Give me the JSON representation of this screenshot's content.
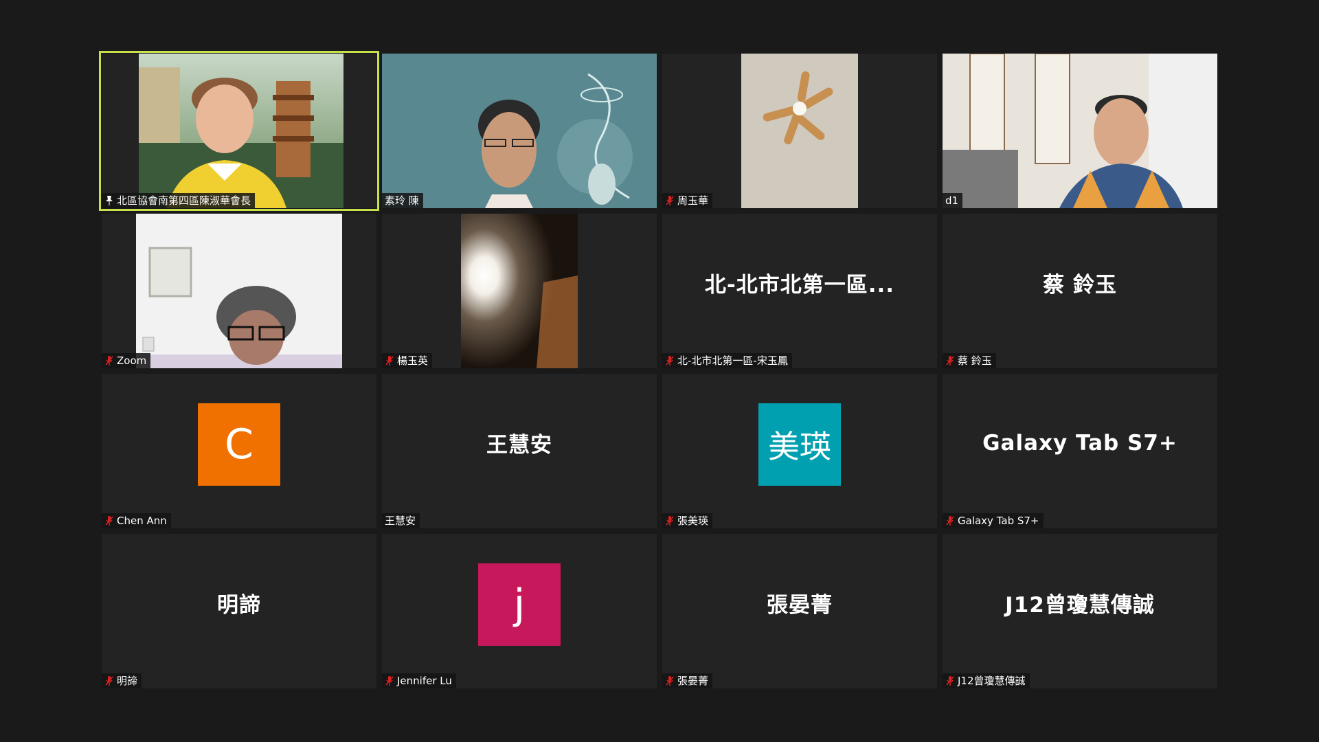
{
  "tiles": [
    {
      "name": "北區協會南第四區陳淑華會長",
      "big": "",
      "avatar": "",
      "color": ""
    },
    {
      "name": "素玲 陳",
      "big": "",
      "avatar": "",
      "color": ""
    },
    {
      "name": "周玉華",
      "big": "",
      "avatar": "",
      "color": ""
    },
    {
      "name": "d1",
      "big": "",
      "avatar": "",
      "color": ""
    },
    {
      "name": "Zoom",
      "big": "",
      "avatar": "",
      "color": ""
    },
    {
      "name": "楊玉英",
      "big": "",
      "avatar": "",
      "color": ""
    },
    {
      "name": "北-北市北第一區-宋玉鳳",
      "big": "北-北市北第一區...",
      "avatar": "",
      "color": ""
    },
    {
      "name": "蔡 鈴玉",
      "big": "蔡 鈴玉",
      "avatar": "",
      "color": ""
    },
    {
      "name": "Chen Ann",
      "big": "",
      "avatar": "C",
      "color": "#f07000"
    },
    {
      "name": "王慧安",
      "big": "王慧安",
      "avatar": "",
      "color": ""
    },
    {
      "name": "張美瑛",
      "big": "",
      "avatar": "美瑛",
      "color": "#00a0b0"
    },
    {
      "name": "Galaxy Tab S7+",
      "big": "Galaxy Tab S7+",
      "avatar": "",
      "color": ""
    },
    {
      "name": "明諦",
      "big": "明諦",
      "avatar": "",
      "color": ""
    },
    {
      "name": "Jennifer Lu",
      "big": "",
      "avatar": "j",
      "color": "#c8185c"
    },
    {
      "name": "張晏菁",
      "big": "張晏菁",
      "avatar": "",
      "color": ""
    },
    {
      "name": "J12曾瓊慧傳誠",
      "big": "J12曾瓊慧傳誠",
      "avatar": "",
      "color": ""
    }
  ],
  "colors": {
    "active_border": "#c8e04a",
    "muted_mic": "#e02020",
    "background": "#1a1a1a"
  },
  "icons": {
    "muted": "mic-muted-icon",
    "pinned": "pin-icon"
  }
}
